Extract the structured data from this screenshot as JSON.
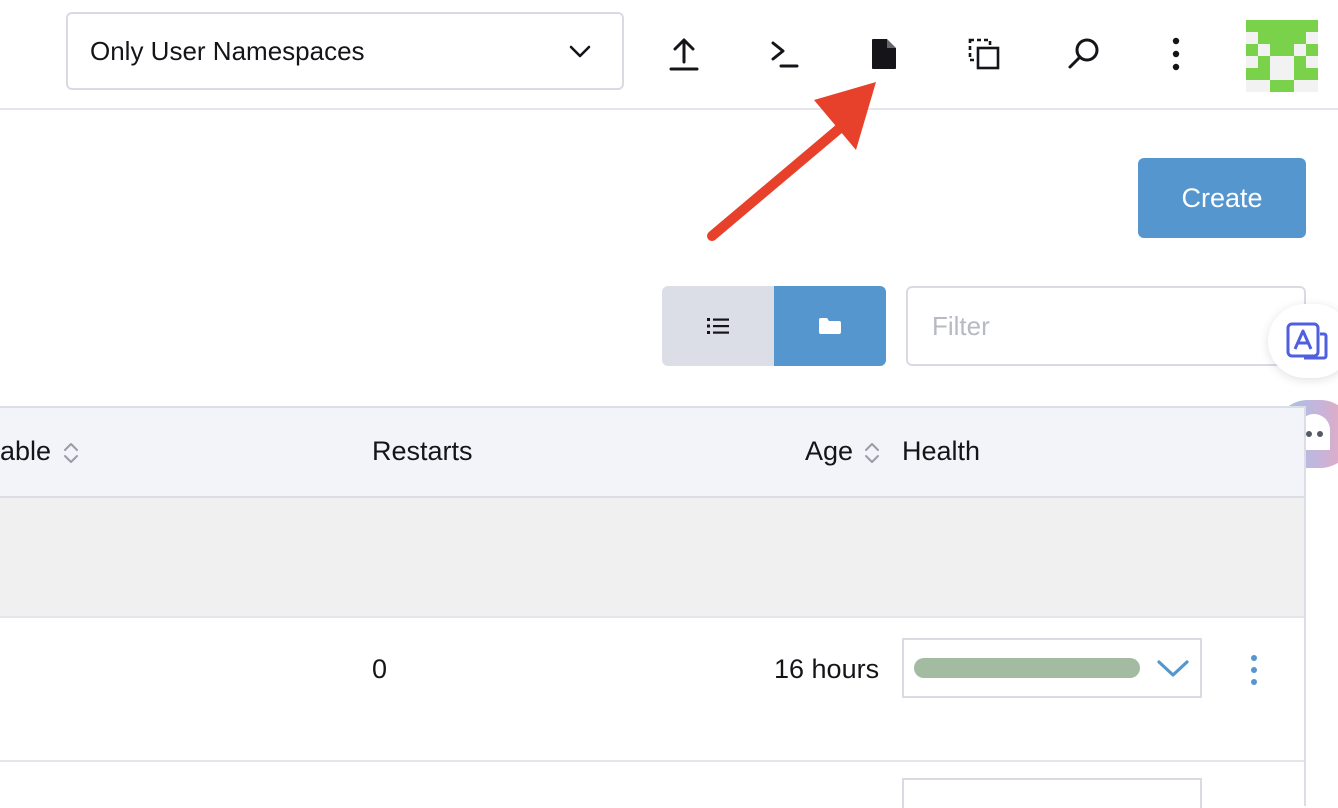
{
  "header": {
    "namespace_filter": "Only User Namespaces",
    "icons": [
      "upload-icon",
      "terminal-icon",
      "file-icon",
      "copy-icon",
      "search-icon",
      "more-vertical-icon"
    ],
    "avatar_colors": [
      "#7ad24a",
      "#f2f2f2"
    ]
  },
  "toolbar": {
    "create_label": "Create",
    "filter_placeholder": "Filter",
    "accent_color": "#5596cf"
  },
  "table": {
    "columns": [
      "able",
      "Restarts",
      "Age",
      "Health"
    ],
    "rows": [
      {
        "restarts": "0",
        "age": "16 hours",
        "health_color": "#a3bba0"
      }
    ]
  },
  "annotation": {
    "arrow_color": "#e8412b"
  }
}
